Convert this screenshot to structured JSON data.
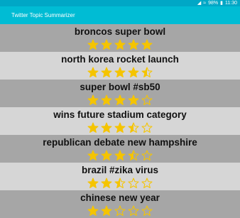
{
  "status_bar": {
    "signal_icon": "signal-icon",
    "wifi_icon": "wifi-icon",
    "battery_text": "98%",
    "battery_icon": "battery-icon",
    "time": "11:30"
  },
  "app_bar": {
    "title": "Twitter Topic Summarizer"
  },
  "colors": {
    "status_bar": "#00a7c6",
    "app_bar": "#00bcd4",
    "star": "#f5c400",
    "row_dark": "#a6a6a6",
    "row_light": "#d6d6d6"
  },
  "topics": [
    {
      "title": "broncos super bowl",
      "rating": 5
    },
    {
      "title": "north korea rocket launch",
      "rating": 4.5
    },
    {
      "title": "super bowl #sb50",
      "rating": 4
    },
    {
      "title": "wins future stadium category",
      "rating": 3.5
    },
    {
      "title": "republican debate new hampshire",
      "rating": 3.5
    },
    {
      "title": "brazil #zika virus",
      "rating": 2.5
    },
    {
      "title": "chinese new year",
      "rating": 2
    }
  ]
}
